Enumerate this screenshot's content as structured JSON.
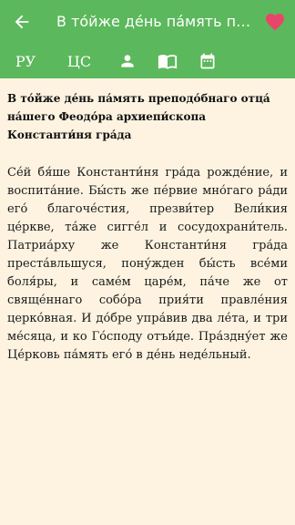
{
  "appbar": {
    "title": "В то́йже де́нь па́мять преподо́бнаго отца́ на́шего Феодо́ра архиепи́скопа Константи́ня гра́да",
    "back_icon": "arrow-left-icon",
    "favorite_icon": "heart-icon",
    "favorite_color": "#e8456b"
  },
  "tabs": [
    {
      "label": "РУ"
    },
    {
      "label": "ЦС"
    },
    {
      "icon": "person-icon"
    },
    {
      "icon": "open-book-icon"
    },
    {
      "icon": "calendar-icon"
    }
  ],
  "article": {
    "heading": "В то́йже де́нь па́мять преподо́бнаго отца́ на́шего Феодо́ра архиепи́скопа Константи́ня гра́да",
    "body": "Се́й бя́ше Константи́ня гра́да рожде́ние, и воспита́ние. Бы́сть же пе́рвие мно́гаго ра́ди его́ благоче́стия, презви́тер Вели́кия це́ркве, та́же сигге́л и сосудохрани́тель. Патриа́рху же Константи́ня гра́да преста́вльшуся, пону́жден бы́сть все́ми боля́ры, и саме́м царе́м, па́че же от свяще́ннаго собо́ра прия́ти правле́ния церко́вная. И до́бре упра́вив два ле́та, и три ме́сяца, и ко Го́споду отъи́де. Пра́здну́ет же Це́рковь па́мять его́ в де́нь неде́льный."
  },
  "colors": {
    "appbar": "#5cb85c",
    "background": "#fdf3e0"
  }
}
